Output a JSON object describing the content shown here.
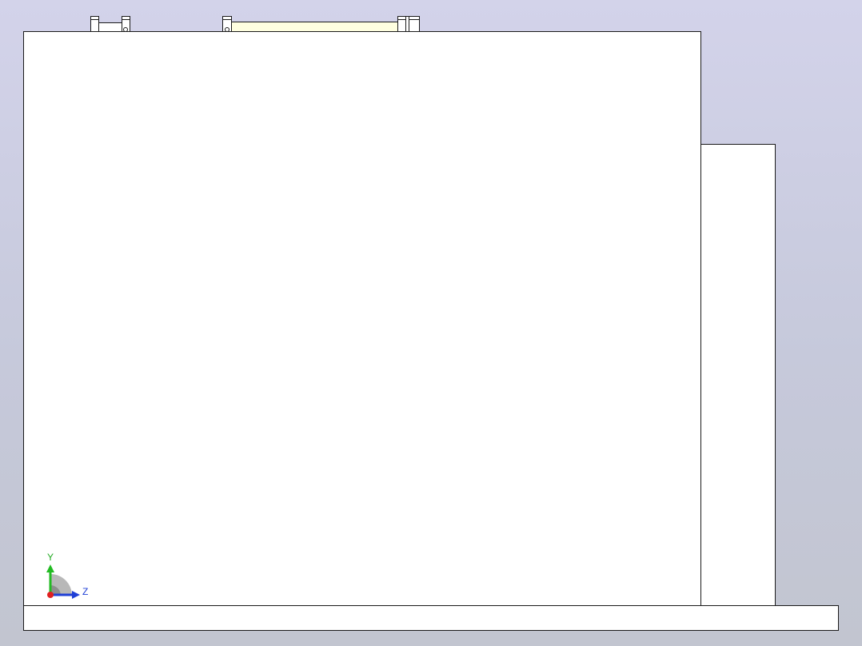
{
  "viewport": {
    "background_top": "#d3d3ea",
    "background_bottom": "#c2c5d0"
  },
  "model": {
    "face_color": "#ffffff",
    "edge_color": "#1a1a1a",
    "fixture_color": "#ffffe0"
  },
  "triad": {
    "y_label": "Y",
    "z_label": "Z",
    "y_color": "#22bb22",
    "z_color": "#1f3fd6",
    "x_color": "#e02020",
    "label_y_color": "#22aa22",
    "label_z_color": "#1f3fd6"
  }
}
